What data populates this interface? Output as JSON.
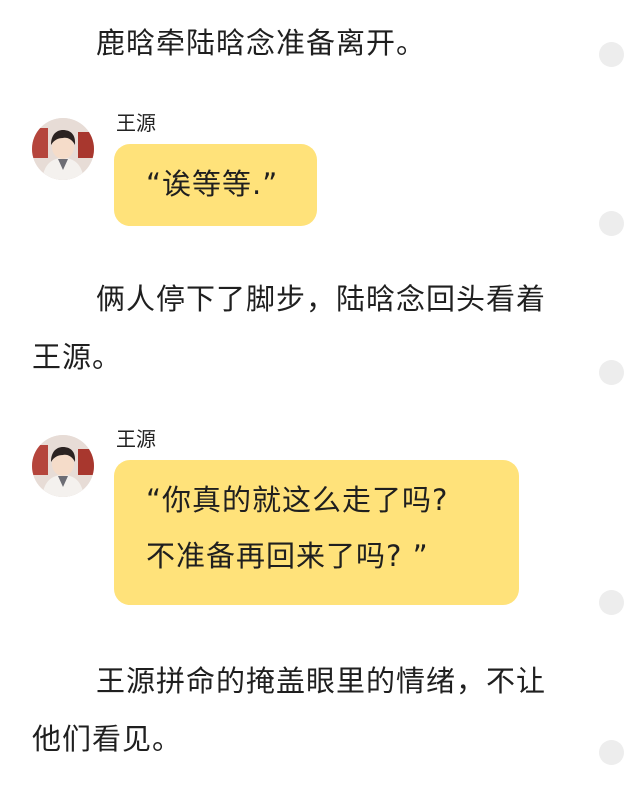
{
  "paragraphs": [
    "鹿晗牵陆晗念准备离开。",
    "俩人停下了脚步，陆晗念回头看着王源。",
    "王源拼命的掩盖眼里的情绪，不让他们看见。"
  ],
  "dialogues": [
    {
      "speaker": "王源",
      "avatar_icon": "boy-portrait-avatar",
      "lines": [
        "“诶等等.”"
      ]
    },
    {
      "speaker": "王源",
      "avatar_icon": "boy-portrait-avatar",
      "lines": [
        "“你真的就这么走了吗?",
        "不准备再回来了吗? ”"
      ]
    }
  ],
  "comment_icon": "comment-dot-icon",
  "colors": {
    "bubble": "#ffe27a",
    "text": "#1f1f1f",
    "comment_dot": "#ededed"
  }
}
